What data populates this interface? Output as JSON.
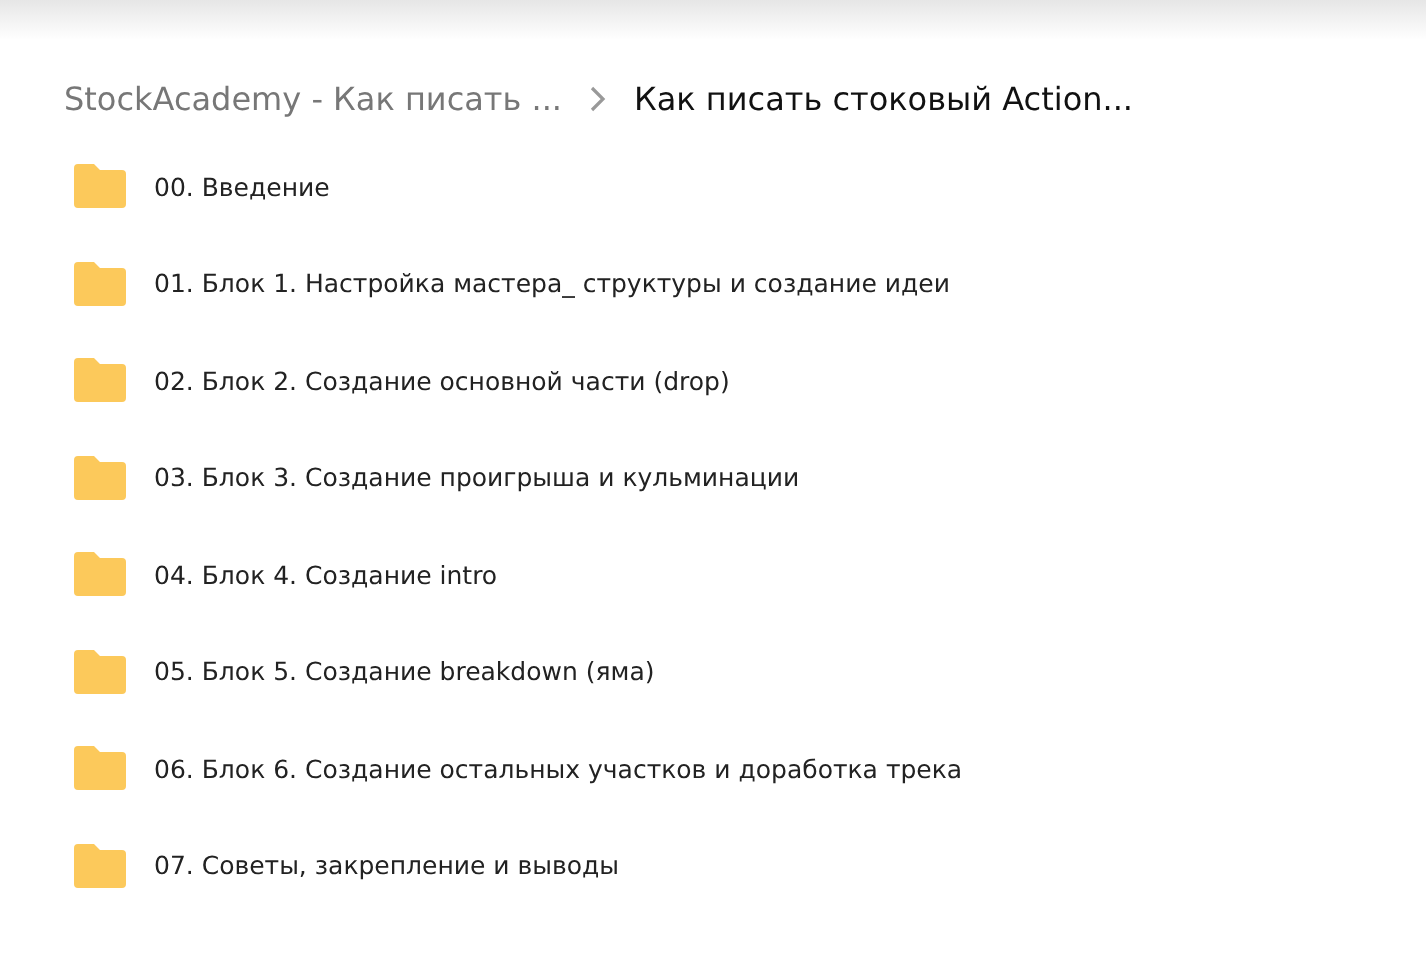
{
  "breadcrumb": [
    {
      "label": "StockAcademy - Как писать ...",
      "current": false
    },
    {
      "label": "Как писать стоковый Action...",
      "current": true
    }
  ],
  "folders": [
    {
      "name": "00. Введение"
    },
    {
      "name": "01. Блок 1. Настройка мастера_ структуры и создание идеи"
    },
    {
      "name": "02. Блок 2. Создание основной части (drop)"
    },
    {
      "name": "03. Блок 3. Создание проигрыша и кульминации"
    },
    {
      "name": "04. Блок 4. Создание intro"
    },
    {
      "name": "05. Блок 5. Создание breakdown (яма)"
    },
    {
      "name": "06. Блок 6. Создание остальных участков и доработка трека"
    },
    {
      "name": "07. Советы, закрепление и выводы"
    }
  ]
}
